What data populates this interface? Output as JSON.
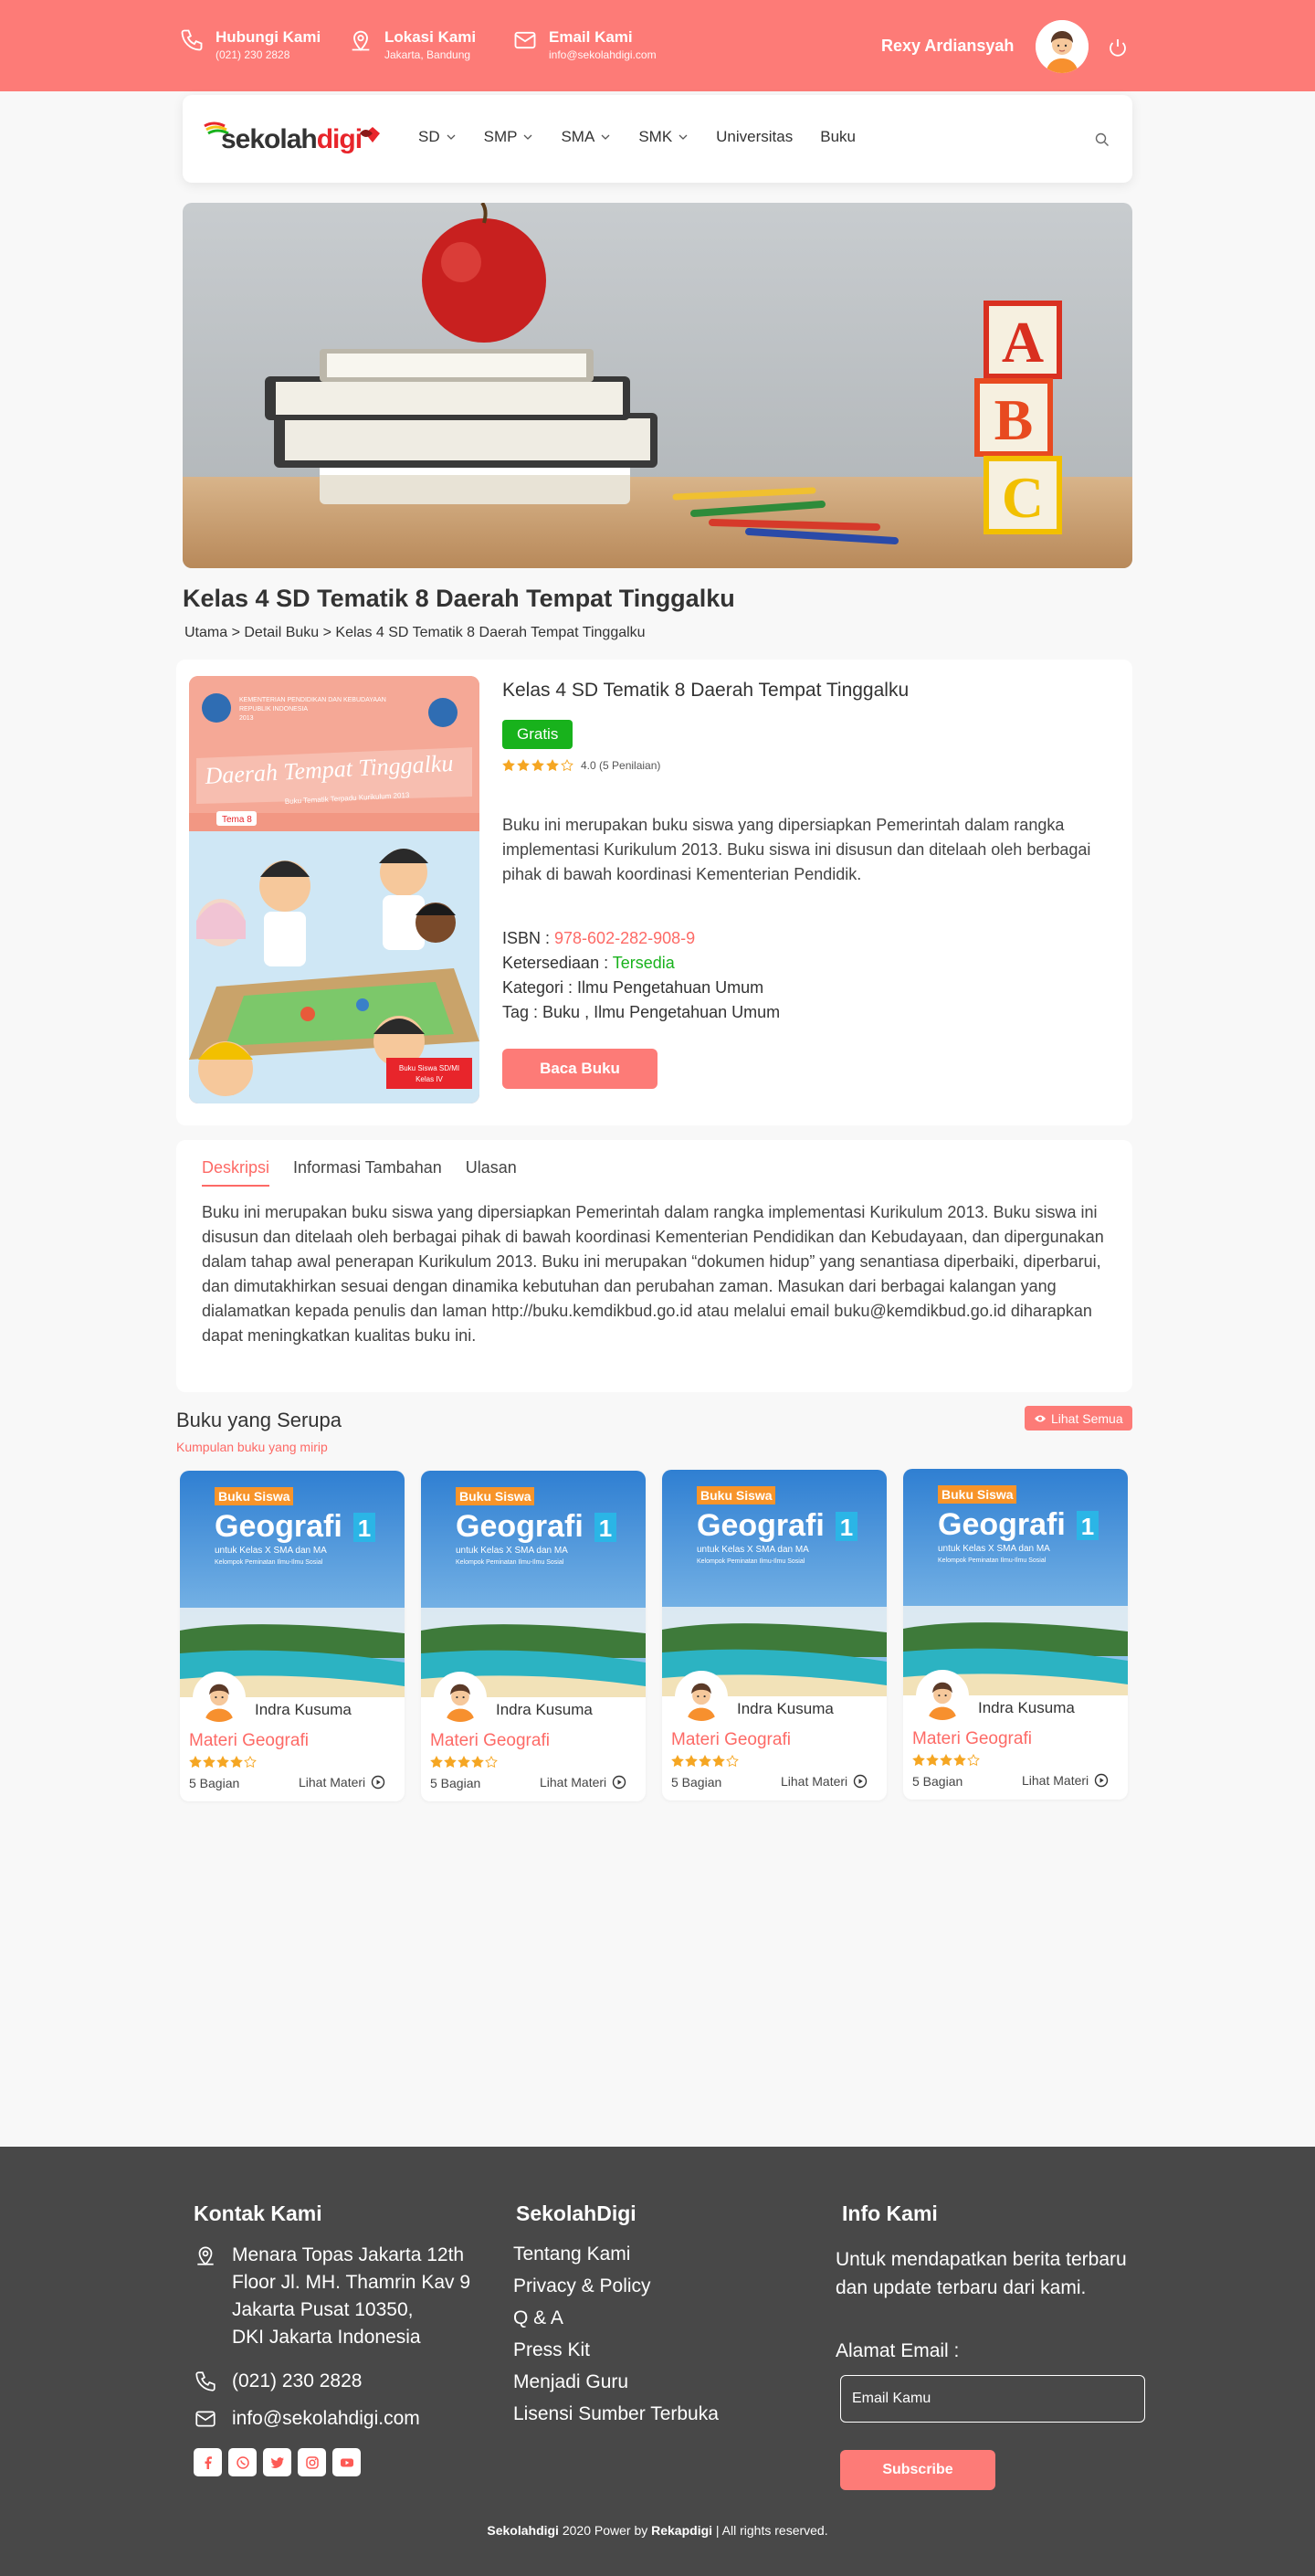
{
  "topbar": {
    "contact_title": "Hubungi Kami",
    "contact_sub": "(021) 230 2828",
    "location_title": "Lokasi Kami",
    "location_sub": "Jakarta, Bandung",
    "email_title": "Email Kami",
    "email_sub": "info@sekolahdigi.com",
    "user_name": "Rexy Ardiansyah"
  },
  "nav": {
    "logo_a": "sekolah",
    "logo_b": "digi",
    "items": [
      "SD",
      "SMP",
      "SMA",
      "SMK",
      "Universitas",
      "Buku"
    ]
  },
  "page": {
    "title": "Kelas 4 SD Tematik 8 Daerah Tempat Tinggalku",
    "breadcrumb": "Utama > Detail Buku > Kelas 4 SD Tematik 8 Daerah Tempat Tinggalku"
  },
  "book": {
    "title": "Kelas 4 SD Tematik 8 Daerah Tempat Tinggalku",
    "badge": "Gratis",
    "rating_value": 4,
    "rating_text": "4.0 (5 Penilaian)",
    "description": "Buku ini merupakan buku siswa yang dipersiapkan Pemerintah dalam rangka implementasi Kurikulum 2013. Buku siswa ini disusun dan ditelaah oleh berbagai pihak di bawah koordinasi Kementerian Pendidik.",
    "isbn_label": "ISBN : ",
    "isbn": "978-602-282-908-9",
    "avail_label": "Ketersediaan : ",
    "avail": "Tersedia",
    "cat_label": "Kategori",
    "cat": " : Ilmu Pengetahuan Umum",
    "tag_label": "Tag",
    "tag": " : Buku , Ilmu Pengetahuan Umum",
    "read_button": "Baca Buku",
    "cover": {
      "ministry": "KEMENTERIAN PENDIDIKAN DAN KEBUDAYAAN REPUBLIK INDONESIA 2013",
      "title": "Daerah Tempat Tinggalku",
      "subtitle": "Buku Tematik Terpadu Kurikulum 2013",
      "tema": "Tema 8",
      "level": "Buku Siswa SD/MI Kelas IV"
    }
  },
  "tabs": {
    "items": [
      "Deskripsi",
      "Informasi Tambahan",
      "Ulasan"
    ],
    "active": "Deskripsi",
    "text": "Buku ini merupakan buku siswa yang dipersiapkan Pemerintah dalam rangka implementasi Kurikulum 2013. Buku siswa ini disusun dan ditelaah oleh berbagai pihak di bawah koordinasi Kementerian Pendidikan dan Kebudayaan, dan dipergunakan dalam tahap awal penerapan Kurikulum 2013. Buku ini merupakan “dokumen hidup” yang senantiasa diperbaiki, diperbarui, dan dimutakhirkan sesuai dengan dinamika kebutuhan dan perubahan zaman. Masukan dari berbagai kalangan yang dialamatkan kepada penulis dan laman http://buku.kemdikbud.go.id atau melalui email buku@kemdikbud.go.id diharapkan dapat meningkatkan kualitas buku ini."
  },
  "similar": {
    "title": "Buku yang Serupa",
    "subtitle": "Kumpulan buku yang mirip",
    "see_all": "Lihat Semua",
    "cards": [
      {
        "badge": "Buku Siswa",
        "book": "Geografi",
        "num": "1",
        "line1": "untuk Kelas X SMA dan MA",
        "line2": "Kelompok Peminatan Ilmu-Ilmu Sosial",
        "author": "Indra Kusuma",
        "title": "Materi Geografi",
        "rating": 4,
        "parts": "5 Bagian",
        "link": "Lihat Materi"
      },
      {
        "badge": "Buku Siswa",
        "book": "Geografi",
        "num": "1",
        "line1": "untuk Kelas X SMA dan MA",
        "line2": "Kelompok Peminatan Ilmu-Ilmu Sosial",
        "author": "Indra Kusuma",
        "title": "Materi Geografi",
        "rating": 4,
        "parts": "5 Bagian",
        "link": "Lihat Materi"
      },
      {
        "badge": "Buku Siswa",
        "book": "Geografi",
        "num": "1",
        "line1": "untuk Kelas X SMA dan MA",
        "line2": "Kelompok Peminatan Ilmu-Ilmu Sosial",
        "author": "Indra Kusuma",
        "title": "Materi Geografi",
        "rating": 4,
        "parts": "5 Bagian",
        "link": "Lihat Materi"
      },
      {
        "badge": "Buku Siswa",
        "book": "Geografi",
        "num": "1",
        "line1": "untuk Kelas X SMA dan MA",
        "line2": "Kelompok Peminatan Ilmu-Ilmu Sosial",
        "author": "Indra Kusuma",
        "title": "Materi Geografi",
        "rating": 4,
        "parts": "5 Bagian",
        "link": "Lihat Materi"
      }
    ]
  },
  "footer": {
    "contact_heading": "Kontak Kami",
    "address_l1": "Menara Topas Jakarta 12th",
    "address_l2": "Floor Jl. MH. Thamrin Kav 9",
    "address_l3": "Jakarta Pusat 10350,",
    "address_l4": "DKI Jakarta Indonesia",
    "phone": "(021) 230 2828",
    "email": "info@sekolahdigi.com",
    "brand_heading": "SekolahDigi",
    "links": [
      "Tentang Kami",
      "Privacy & Policy",
      "Q & A",
      "Press Kit",
      "Menjadi Guru",
      "Lisensi Sumber Terbuka"
    ],
    "info_heading": "Info Kami",
    "info_text": "Untuk mendapatkan berita terbaru dan update terbaru dari kami.",
    "email_label": "Alamat Email :",
    "email_placeholder": "Email Kamu",
    "subscribe": "Subscribe",
    "copy_brand": "Sekolahdigi",
    "copy_mid": " 2020 Power by ",
    "copy_power": "Rekapdigi",
    "copy_end": " | All rights reserved."
  },
  "colors": {
    "primary": "#fd7b77",
    "accent_red": "#fd6a66",
    "green": "#18b21c",
    "footer_bg": "#484848",
    "star": "#f5a623"
  }
}
